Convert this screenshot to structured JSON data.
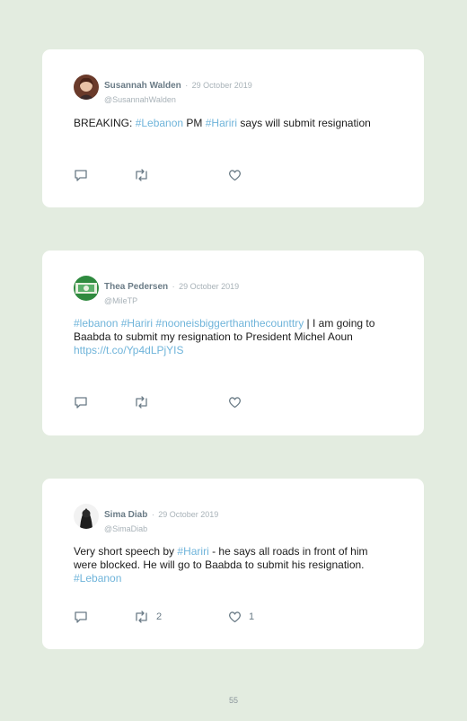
{
  "tweets": [
    {
      "name": "Susannah Walden",
      "sep": "·",
      "date": "29 October 2019",
      "handle": "@SusannahWalden",
      "body": [
        {
          "t": "BREAKING: ",
          "k": "text"
        },
        {
          "t": "#Lebanon",
          "k": "tag"
        },
        {
          "t": " PM ",
          "k": "text"
        },
        {
          "t": "#Hariri",
          "k": "tag"
        },
        {
          "t": " says will submit resignation",
          "k": "text"
        }
      ],
      "retweets": "",
      "likes": ""
    },
    {
      "name": "Thea Pedersen",
      "sep": "·",
      "date": "29 October 2019",
      "handle": "@MileTP",
      "body": [
        {
          "t": "#lebanon",
          "k": "tag"
        },
        {
          "t": " ",
          "k": "text"
        },
        {
          "t": "#Hariri",
          "k": "tag"
        },
        {
          "t": " ",
          "k": "text"
        },
        {
          "t": "#nooneisbiggerthanthecounttry",
          "k": "tag"
        },
        {
          "t": " | I am going to Baabda to submit my resignation to President Michel Aoun",
          "k": "text"
        },
        {
          "t": "https://t.co/Yp4dLPjYIS",
          "k": "link"
        }
      ],
      "retweets": "",
      "likes": ""
    },
    {
      "name": "Sima Diab",
      "sep": "·",
      "date": "29 October 2019",
      "handle": "@SimaDiab",
      "body": [
        {
          "t": "Very short speech by ",
          "k": "text"
        },
        {
          "t": "#Hariri",
          "k": "tag"
        },
        {
          "t": " - he says all roads in front of him were blocked. He will go to Baabda to submit his resignation. ",
          "k": "text"
        },
        {
          "t": "#Lebanon",
          "k": "tag"
        }
      ],
      "retweets": "2",
      "likes": "1"
    }
  ],
  "page_number": "55",
  "colors": {
    "tag": "#6fb4da",
    "background": "#e3ece0",
    "card": "#ffffff"
  },
  "icons": [
    "reply-icon",
    "retweet-icon",
    "like-icon"
  ]
}
